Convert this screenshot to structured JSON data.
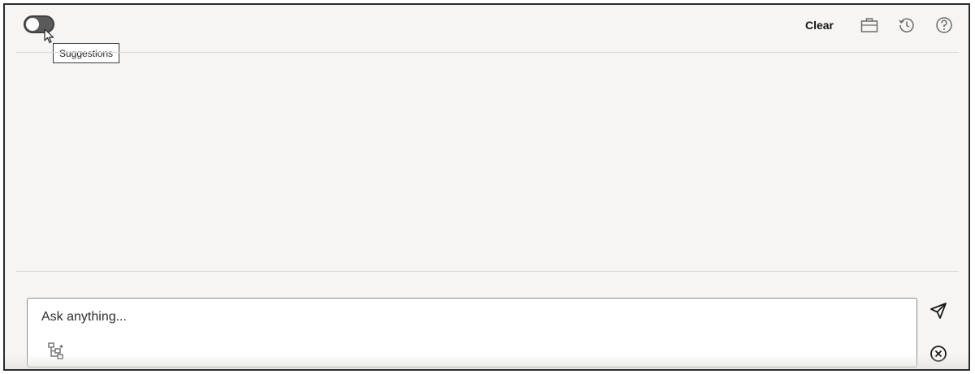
{
  "header": {
    "suggestions_toggle": {
      "tooltip": "Suggestions",
      "state": "off"
    },
    "clear_label": "Clear",
    "icons": {
      "briefcase": "briefcase-icon",
      "history": "history-icon",
      "help": "help-icon"
    }
  },
  "composer": {
    "placeholder": "Ask anything...",
    "attach_icon": "data-source-icon",
    "send_icon": "send-icon",
    "cancel_icon": "cancel-icon"
  },
  "colors": {
    "background": "#f6f5f4",
    "toggle": "#5a5a5a",
    "divider": "#dad8d5",
    "text": "#161616"
  }
}
